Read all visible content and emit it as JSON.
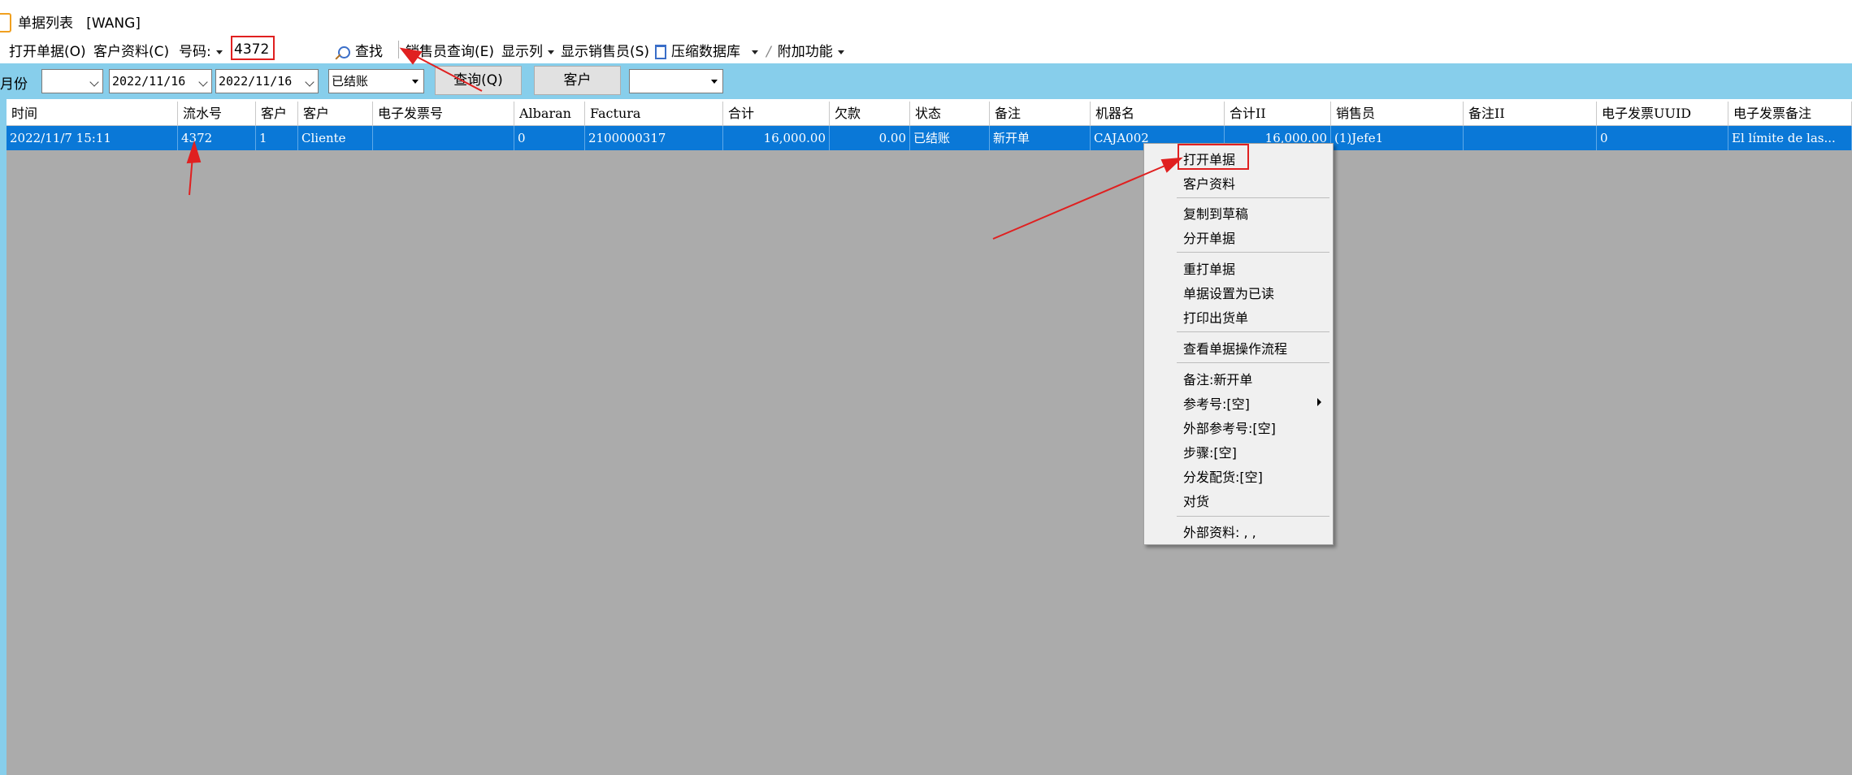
{
  "window": {
    "title": "单据列表",
    "user": "[WANG]"
  },
  "toolbar": {
    "open_doc": "打开单据(O)",
    "customer_info": "客户资料(C)",
    "number_label": "号码:",
    "number_value": "4372",
    "search": "查找",
    "salesperson_query": "销售员查询(E)",
    "show_columns": "显示列",
    "show_salesperson": "显示销售员(S)",
    "compress_db": "压缩数据库",
    "extra_features": "附加功能"
  },
  "filters": {
    "month_label": "月份",
    "month_value": "",
    "date_from": "2022/11/16",
    "date_to": "2022/11/16",
    "status": "已结账",
    "query_button": "查询(Q)",
    "customer_button": "客户",
    "customer_select": ""
  },
  "table": {
    "columns": [
      "时间",
      "流水号",
      "客户",
      "客户",
      "电子发票号",
      "Albaran",
      "Factura",
      "合计",
      "欠款",
      "状态",
      "备注",
      "机器名",
      "合计II",
      "销售员",
      "备注II",
      "电子发票UUID",
      "电子发票备注"
    ],
    "rows": [
      [
        "2022/11/7 15:11",
        "4372",
        "1",
        "Cliente",
        "",
        "0",
        "2100000317",
        "16,000.00",
        "0.00",
        "已结账",
        "新开单",
        "CAJA002",
        "16,000.00",
        "(1)Jefe1",
        "",
        "0",
        "El límite de las..."
      ]
    ]
  },
  "context_menu": {
    "items": [
      "打开单据",
      "客户资料",
      "复制到草稿",
      "分开单据",
      "重打单据",
      "单据设置为已读",
      "打印出货单",
      "查看单据操作流程",
      "备注:新开单",
      "参考号:[空]",
      "外部参考号:[空]",
      "步骤:[空]",
      "分发配货:[空]",
      "对货",
      "外部资料: , ,"
    ]
  },
  "colors": {
    "selection": "#0a78d7",
    "filter_bar": "#87ceeb",
    "grid_bg": "#ababab",
    "annotation": "#e02020"
  }
}
